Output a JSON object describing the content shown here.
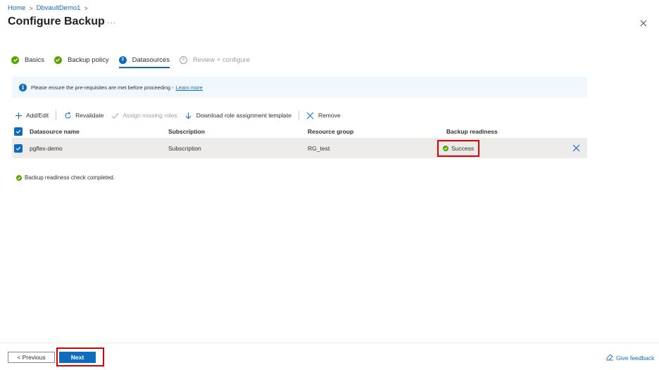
{
  "breadcrumb": {
    "home": "Home",
    "vault": "DbvaultDemo1"
  },
  "page": {
    "title": "Configure Backup",
    "more": "···"
  },
  "steps": [
    {
      "label": "Basics",
      "state": "done"
    },
    {
      "label": "Backup policy",
      "state": "done"
    },
    {
      "label": "Datasources",
      "number": "3",
      "state": "current"
    },
    {
      "label": "Review + configure",
      "number": "4",
      "state": "pending"
    }
  ],
  "info": {
    "text": "Please ensure the pre-requisites are met before proceeding -",
    "link": "Learn more"
  },
  "toolbar": {
    "add_edit": "Add/Edit",
    "revalidate": "Revalidate",
    "assign_roles": "Assign missing roles",
    "download_template": "Download role assignment template",
    "remove": "Remove"
  },
  "table": {
    "headers": [
      "Datasource name",
      "Subscription",
      "Resource group",
      "Backup readiness"
    ],
    "rows": [
      {
        "name": "pgflex-demo",
        "subscription": "Subscription",
        "resource_group": "RG_test",
        "readiness": "Success"
      }
    ]
  },
  "readiness_message": "Backup readiness check completed.",
  "footer": {
    "previous": "< Previous",
    "next": "Next",
    "feedback": "Give feedback"
  },
  "colors": {
    "accent": "#0f6cbd",
    "success": "#57a300",
    "highlight": "#e00000",
    "info_bg": "#eff6fc"
  }
}
